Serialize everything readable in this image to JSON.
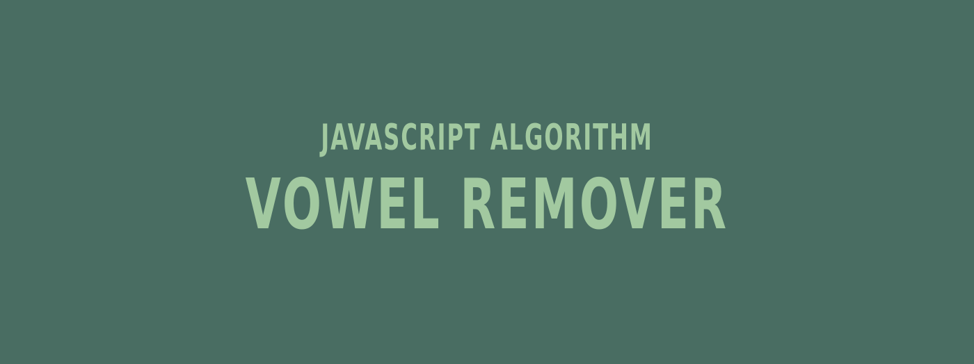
{
  "banner": {
    "subtitle": "JAVASCRIPT ALGORITHM",
    "title": "VOWEL REMOVER"
  },
  "colors": {
    "background": "#496d62",
    "text": "#a2c9a0"
  }
}
